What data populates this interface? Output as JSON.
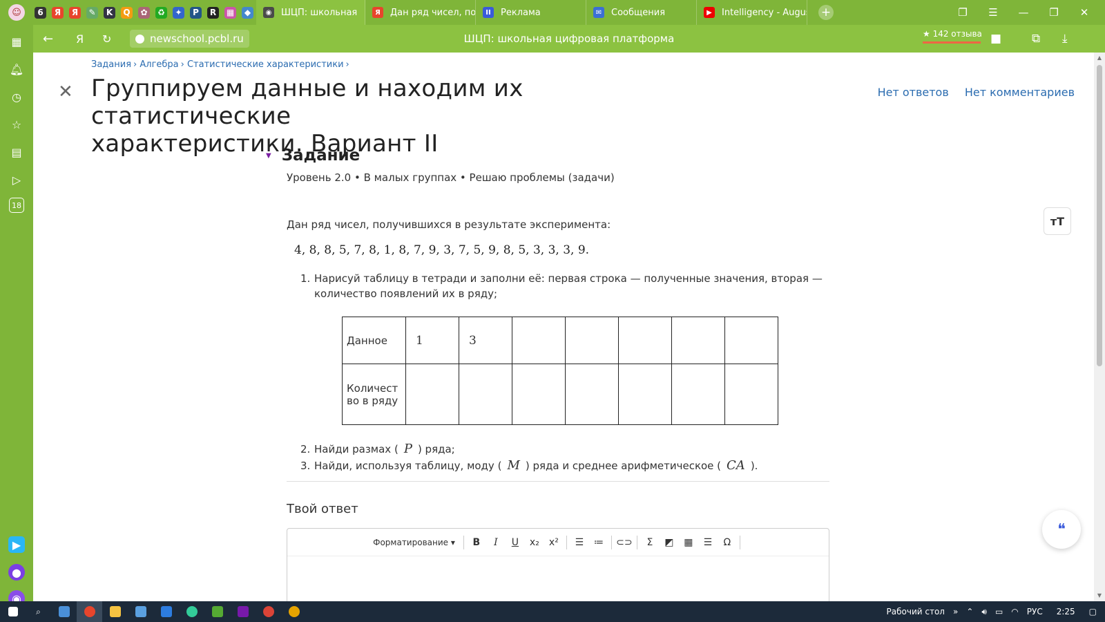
{
  "browser": {
    "tabs": [
      {
        "label": "ШЦП: школьная",
        "active": true
      },
      {
        "label": "Дан ряд чисел, полу"
      },
      {
        "label": "Реклама"
      },
      {
        "label": "Сообщения"
      },
      {
        "label": "Intelligency - August"
      }
    ],
    "url": "newschool.pcbl.ru",
    "page_title": "ШЦП: школьная цифровая платформа",
    "reviews": "★ 142 отзыва",
    "sidebar_badge": "18"
  },
  "page": {
    "breadcrumbs": [
      "Задания",
      "Алгебра",
      "Статистические характеристики"
    ],
    "title_line1": "Группируем данные и находим их статистические",
    "title_line2": "характеристики. Вариант II",
    "no_answers": "Нет ответов",
    "no_comments": "Нет комментариев"
  },
  "task": {
    "heading": "Задание",
    "meta": "Уровень 2.0 • В малых группах  • Решаю проблемы (задачи)",
    "intro": "Дан ряд чисел, получившихся в результате эксперимента:",
    "sequence": "4, 8, 8, 5, 7, 8, 1, 8, 7, 9, 3, 7, 5, 9, 8, 5, 3, 3, 3, 9.",
    "item1_num": "1.",
    "item1": "Нарисуй таблицу в тетради и заполни её: первая строка — полученные значения, вторая — количество появлений их в ряду;",
    "table": {
      "row1_header": "Данное",
      "row1_values": [
        "1",
        "3",
        "",
        "",
        "",
        "",
        ""
      ],
      "row2_header_line1": "Количест",
      "row2_header_line2": "во в ряду"
    },
    "item2_num": "2.",
    "item2_pre": "Найди размах (",
    "item2_sym": "P",
    "item2_post": ") ряда;",
    "item3_num": "3.",
    "item3_pre": "Найди, используя таблицу, моду (",
    "item3_sym1": "M",
    "item3_mid": ") ряда и среднее арифметическое (",
    "item3_sym2": "CA",
    "item3_post": ")."
  },
  "answer": {
    "title": "Твой ответ",
    "format_label": "Форматирование"
  },
  "taskbar": {
    "desktop": "Рабочий стол",
    "lang": "РУС",
    "time": "2:25"
  },
  "colors": {
    "browser_green": "#7fb539",
    "link": "#2b6cb0",
    "taskbar": "#1c2a3a"
  }
}
